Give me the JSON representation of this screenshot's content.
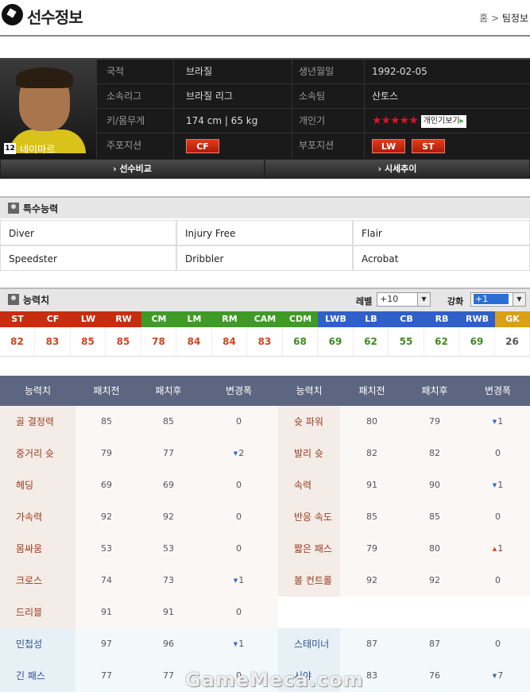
{
  "header": {
    "title": "선수정보",
    "breadcrumb_home": "홈",
    "breadcrumb_sep": ">",
    "breadcrumb_current": "팀정보"
  },
  "player": {
    "number": "12",
    "name": "네이마르",
    "nation_label": "국적",
    "nation": "브라질",
    "birth_label": "생년월일",
    "birth": "1992-02-05",
    "league_label": "소속리그",
    "league": "브라질 리그",
    "team_label": "소속팀",
    "team": "산토스",
    "body_label": "키/몸무게",
    "body": "174 cm | 65 kg",
    "skill_label": "개인기",
    "skill_stars": "★★★★★",
    "skill_button": "개인기보기",
    "main_pos_label": "주포지션",
    "main_pos": [
      "CF"
    ],
    "sub_pos_label": "부포지션",
    "sub_pos": [
      "LW",
      "ST"
    ]
  },
  "compare": {
    "left": "› 선수비교",
    "right": "› 시세추이"
  },
  "special": {
    "title": "특수능력",
    "items": [
      "Diver",
      "Injury Free",
      "Flair",
      "Speedster",
      "Dribbler",
      "Acrobat"
    ]
  },
  "stats": {
    "title": "능력치",
    "level_label": "레벨",
    "level_value": "+10",
    "enhance_label": "강화",
    "enhance_value": "+1",
    "positions": [
      {
        "pos": "ST",
        "val": "82",
        "hc": "#c82d10",
        "vc": "#d2441e"
      },
      {
        "pos": "CF",
        "val": "83",
        "hc": "#c82d10",
        "vc": "#d2441e"
      },
      {
        "pos": "LW",
        "val": "85",
        "hc": "#c82d10",
        "vc": "#d2441e"
      },
      {
        "pos": "RW",
        "val": "85",
        "hc": "#c82d10",
        "vc": "#d2441e"
      },
      {
        "pos": "CM",
        "val": "78",
        "hc": "#3f9a26",
        "vc": "#d2441e"
      },
      {
        "pos": "LM",
        "val": "84",
        "hc": "#3f9a26",
        "vc": "#d2441e"
      },
      {
        "pos": "RM",
        "val": "84",
        "hc": "#3f9a26",
        "vc": "#d2441e"
      },
      {
        "pos": "CAM",
        "val": "83",
        "hc": "#3f9a26",
        "vc": "#d2441e"
      },
      {
        "pos": "CDM",
        "val": "68",
        "hc": "#3f9a26",
        "vc": "#3f8a1e"
      },
      {
        "pos": "LWB",
        "val": "69",
        "hc": "#2f5fc9",
        "vc": "#3f8a1e"
      },
      {
        "pos": "LB",
        "val": "62",
        "hc": "#2f5fc9",
        "vc": "#3f8a1e"
      },
      {
        "pos": "CB",
        "val": "55",
        "hc": "#2f5fc9",
        "vc": "#3f8a1e"
      },
      {
        "pos": "RB",
        "val": "62",
        "hc": "#2f5fc9",
        "vc": "#3f8a1e"
      },
      {
        "pos": "RWB",
        "val": "69",
        "hc": "#2f5fc9",
        "vc": "#3f8a1e"
      },
      {
        "pos": "GK",
        "val": "26",
        "hc": "#d9a018",
        "vc": "#555555"
      }
    ]
  },
  "table": {
    "headers": [
      "능력치",
      "패치전",
      "패치후",
      "변경폭",
      "능력치",
      "패치전",
      "패치후",
      "변경폭"
    ],
    "rows": [
      {
        "n1": "골 결정력",
        "b1": "85",
        "a1": "85",
        "d1": "0",
        "t1": "",
        "n2": "슛 파워",
        "b2": "80",
        "a2": "79",
        "d2": "1",
        "t2": "down",
        "g": "a"
      },
      {
        "n1": "중거리 슛",
        "b1": "79",
        "a1": "77",
        "d1": "2",
        "t1": "down",
        "n2": "발리 슛",
        "b2": "82",
        "a2": "82",
        "d2": "0",
        "t2": "",
        "g": "a"
      },
      {
        "n1": "헤딩",
        "b1": "69",
        "a1": "69",
        "d1": "0",
        "t1": "",
        "n2": "속력",
        "b2": "91",
        "a2": "90",
        "d2": "1",
        "t2": "down",
        "g": "a"
      },
      {
        "n1": "가속력",
        "b1": "92",
        "a1": "92",
        "d1": "0",
        "t1": "",
        "n2": "반응 속도",
        "b2": "85",
        "a2": "85",
        "d2": "0",
        "t2": "",
        "g": "a"
      },
      {
        "n1": "몸싸움",
        "b1": "53",
        "a1": "53",
        "d1": "0",
        "t1": "",
        "n2": "짧은 패스",
        "b2": "79",
        "a2": "80",
        "d2": "1",
        "t2": "up",
        "g": "a"
      },
      {
        "n1": "크로스",
        "b1": "74",
        "a1": "73",
        "d1": "1",
        "t1": "down",
        "n2": "볼 컨트롤",
        "b2": "92",
        "a2": "92",
        "d2": "0",
        "t2": "",
        "g": "a"
      },
      {
        "n1": "드리블",
        "b1": "91",
        "a1": "91",
        "d1": "0",
        "t1": "",
        "n2": "",
        "b2": "",
        "a2": "",
        "d2": "",
        "t2": "",
        "g": "a"
      },
      {
        "n1": "민첩성",
        "b1": "97",
        "a1": "96",
        "d1": "1",
        "t1": "down",
        "n2": "스태미너",
        "b2": "87",
        "a2": "87",
        "d2": "0",
        "t2": "",
        "g": "b"
      },
      {
        "n1": "긴 패스",
        "b1": "77",
        "a1": "77",
        "d1": "0",
        "t1": "",
        "n2": "시야",
        "b2": "83",
        "a2": "76",
        "d2": "7",
        "t2": "down",
        "g": "b"
      }
    ]
  },
  "watermark": "GameMeca.com"
}
